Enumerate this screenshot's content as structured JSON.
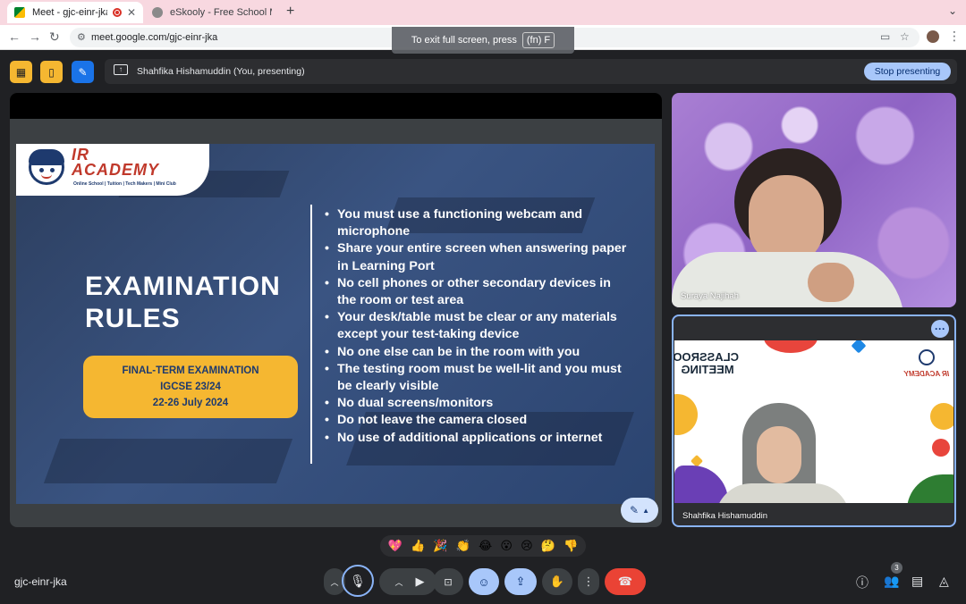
{
  "browser": {
    "tabs": [
      {
        "title": "Meet - gjc-einr-jka",
        "active": true
      },
      {
        "title": "eSkooly - Free School Manag",
        "active": false
      }
    ],
    "new_tab": "+",
    "url": "meet.google.com/gjc-einr-jka",
    "fullscreen_toast": {
      "text": "To exit full screen, press",
      "key": "(fn) F"
    }
  },
  "meet": {
    "presenting_label": "Shahfika Hishamuddin (You, presenting)",
    "stop_presenting": "Stop presenting",
    "meeting_code": "gjc-einr-jka",
    "participant_count": "3",
    "accent": "#a8c7fa",
    "end_call_color": "#ea4335"
  },
  "slide": {
    "logo_line1": "IR",
    "logo_line2": "ACADEMY",
    "logo_sub": "Online School | Tuition | Tech Makers | Mini Club",
    "title_line1": "EXAMINATION",
    "title_line2": "RULES",
    "exam_line1": "FINAL-TERM EXAMINATION",
    "exam_line2": "IGCSE 23/24",
    "exam_line3": "22-26 July 2024",
    "rules": [
      "You must use a functioning webcam and microphone",
      "Share your entire screen when answering paper in Learning Port",
      "No cell phones or other secondary devices in the room or test area",
      "Your desk/table must be clear or any materials except your test-taking device",
      "No one else can be in the room with you",
      "The testing room must be well-lit and you must be clearly visible",
      "No dual screens/monitors",
      "Do not leave the camera closed",
      "No use of additional applications or internet"
    ]
  },
  "participants": [
    {
      "name": "Suraya Najihah"
    },
    {
      "name": "Shahfika Hishamuddin",
      "bg_text": "CLASSROOM MEETING",
      "bg_logo": "IR ACADEMY"
    }
  ],
  "reactions": [
    "💖",
    "👍",
    "🎉",
    "👏",
    "😂",
    "😮",
    "😢",
    "🤔",
    "👎"
  ]
}
